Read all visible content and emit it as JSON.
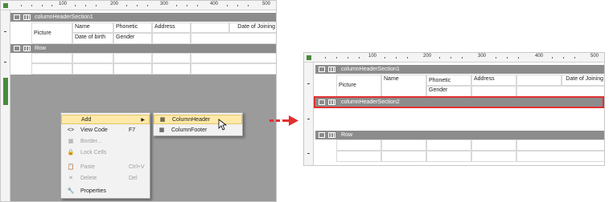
{
  "ruler": {
    "labels": [
      "100",
      "200",
      "300",
      "400",
      "500"
    ]
  },
  "left_panel": {
    "section1": {
      "title": "columnHeaderSection1"
    },
    "header_cells": {
      "picture": "Picture",
      "name": "Name",
      "phonetic": "Phonetic",
      "address": "Address",
      "date_of_joining": "Date of Joining",
      "date_of_birth": "Date of birth",
      "gender": "Gender"
    },
    "row_section": {
      "title": "Row"
    }
  },
  "context_menu": {
    "items": [
      {
        "icon": "",
        "label": "Add",
        "shortcut": "",
        "disabled": false,
        "highlighted": true,
        "has_submenu": true
      },
      {
        "icon": "<>",
        "label": "View Code",
        "shortcut": "F7",
        "disabled": false,
        "highlighted": false,
        "has_submenu": false
      },
      {
        "icon": "▦",
        "label": "Border...",
        "shortcut": "",
        "disabled": true,
        "highlighted": false,
        "has_submenu": false
      },
      {
        "icon": "🔒",
        "label": "Lock Cells",
        "shortcut": "",
        "disabled": true,
        "highlighted": false,
        "has_submenu": false
      },
      {
        "icon": "📋",
        "label": "Paste",
        "shortcut": "Ctrl+V",
        "disabled": true,
        "highlighted": false,
        "has_submenu": false
      },
      {
        "icon": "✕",
        "label": "Delete",
        "shortcut": "Del",
        "disabled": true,
        "highlighted": false,
        "has_submenu": false
      },
      {
        "icon": "🔧",
        "label": "Properties",
        "shortcut": "",
        "disabled": false,
        "highlighted": false,
        "has_submenu": false
      }
    ],
    "submenu": [
      {
        "label": "ColumnHeader",
        "highlighted": true
      },
      {
        "label": "ColumnFooter",
        "highlighted": false
      }
    ]
  },
  "right_panel": {
    "section1": {
      "title": "columnHeaderSection1"
    },
    "header_cells": {
      "picture": "Picture",
      "name": "Name",
      "phonetic": "Phonetic",
      "address": "Address",
      "date_of_joining": "Date of Joining",
      "gender": "Gender"
    },
    "section2": {
      "title": "columnHeaderSection2"
    },
    "row_section": {
      "title": "Row"
    }
  },
  "colors": {
    "highlight_border": "#e03030",
    "arrow": "#e03030",
    "section_band": "#8c8c8c",
    "menu_hot": "#ffe9a8"
  }
}
